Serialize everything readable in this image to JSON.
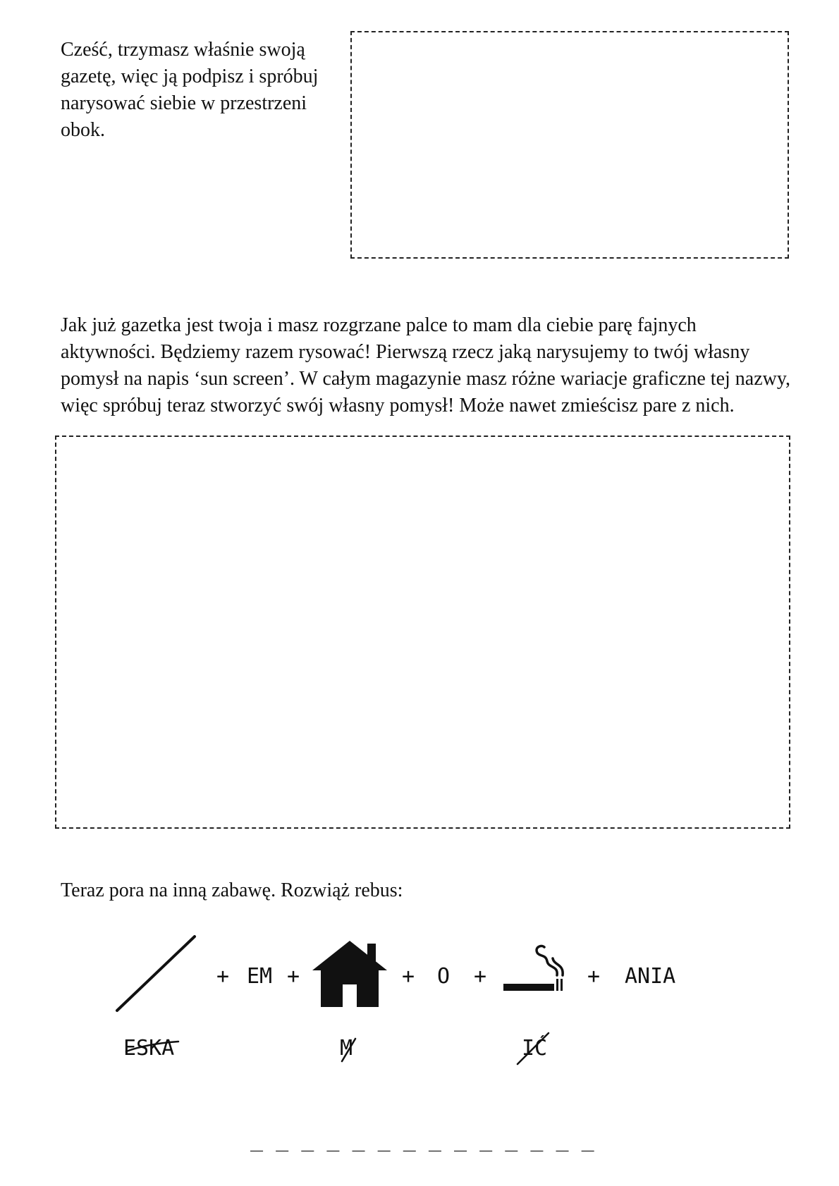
{
  "intro": {
    "line1": "Cześć, trzymasz właśnie swoją",
    "line2": "gazetę, więc ją podpisz i spróbuj",
    "line3": "narysować siebie w przestrzeni",
    "line4": "obok."
  },
  "activity": {
    "line1": "Jak już gazetka jest twoja i masz rozgrzane palce to mam dla ciebie parę fajnych",
    "line2": "aktywności. Będziemy razem rysować! Pierwszą rzecz jaką narysujemy to twój własny",
    "line3": "pomysł na napis ‘sun screen’. W całym magazynie masz różne wariacje graficzne tej nazwy,",
    "line4": "więc spróbuj teraz stworzyć swój własny pomysł! Może nawet zmieścisz pare z nich."
  },
  "rebus": {
    "title": "Teraz pora na inną zabawę. Rozwiąż rebus:",
    "items": {
      "plus1": "+",
      "em": "EM",
      "plus2": "+",
      "plus3": "+",
      "o": "O",
      "plus4": "+",
      "plus5": "+",
      "ania": "ANIA"
    },
    "notes": {
      "slash_note": "ESKA",
      "house_note": "M",
      "cigarette_note": "IĆ"
    },
    "icons": [
      "slash-icon",
      "house-icon",
      "cigarette-icon"
    ],
    "answer_blanks": "_ _ _ _ _ _ _ _ _ _ _ _ _ _"
  }
}
